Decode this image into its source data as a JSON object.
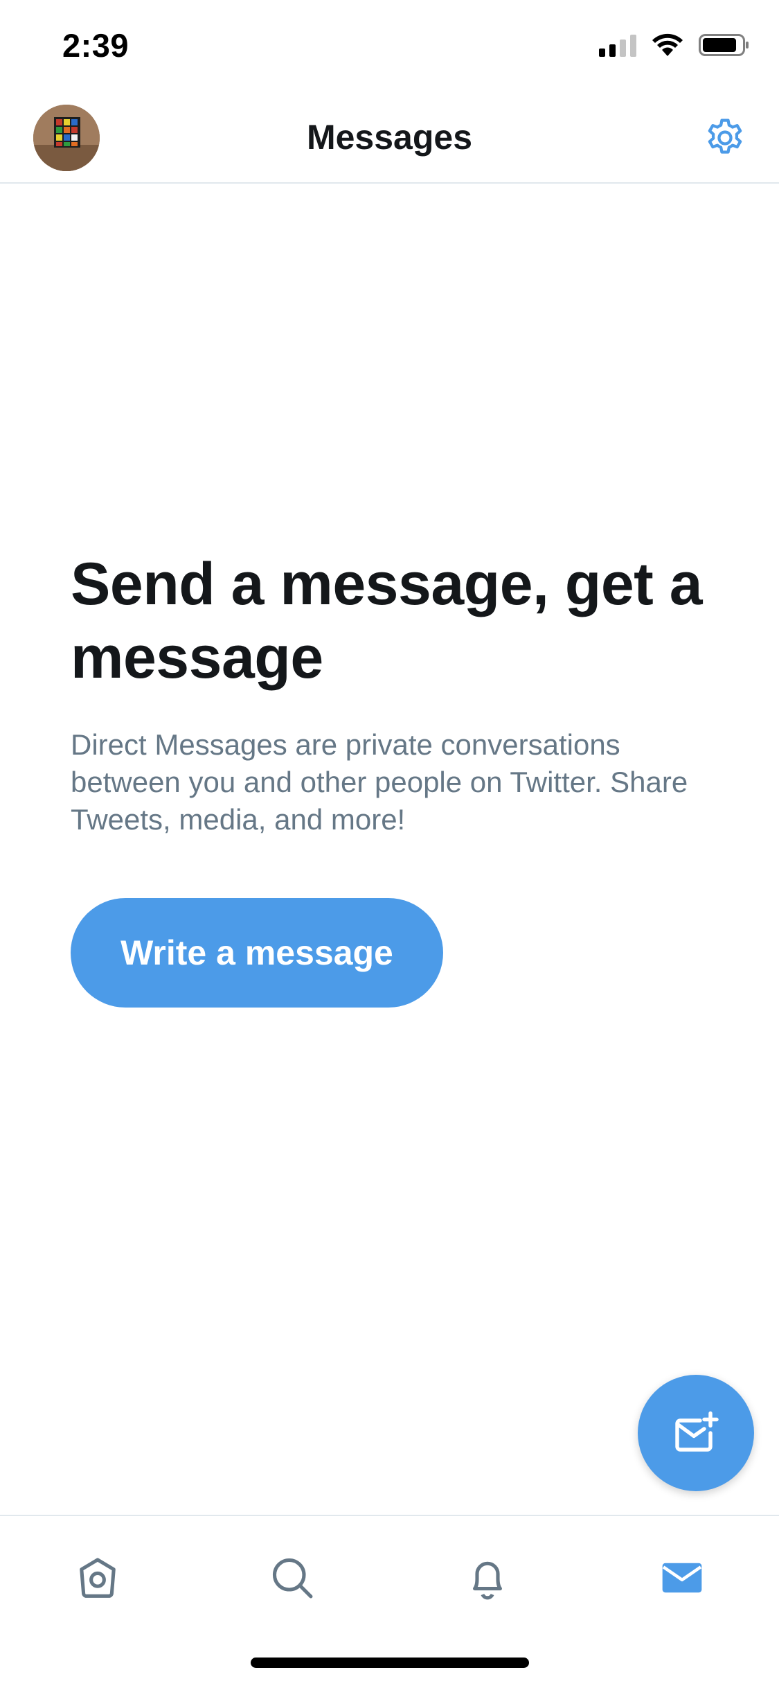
{
  "status_bar": {
    "time": "2:39"
  },
  "header": {
    "title": "Messages",
    "avatar_icon": "profile-avatar-rubiks-cube",
    "settings_icon": "gear-icon"
  },
  "empty_state": {
    "title": "Send a message, get a message",
    "description": "Direct Messages are private conversations between you and other people on Twitter. Share Tweets, media, and more!",
    "button_label": "Write a message"
  },
  "fab": {
    "icon": "new-message-icon"
  },
  "tab_bar": {
    "tabs": [
      {
        "icon": "home-icon",
        "active": false
      },
      {
        "icon": "search-icon",
        "active": false
      },
      {
        "icon": "bell-icon",
        "active": false
      },
      {
        "icon": "mail-icon",
        "active": true
      }
    ]
  },
  "colors": {
    "accent": "#4c9be8",
    "title_text": "#14171a",
    "secondary_text": "#657786",
    "inactive_icon": "#657786",
    "divider": "#e1e8ed"
  }
}
